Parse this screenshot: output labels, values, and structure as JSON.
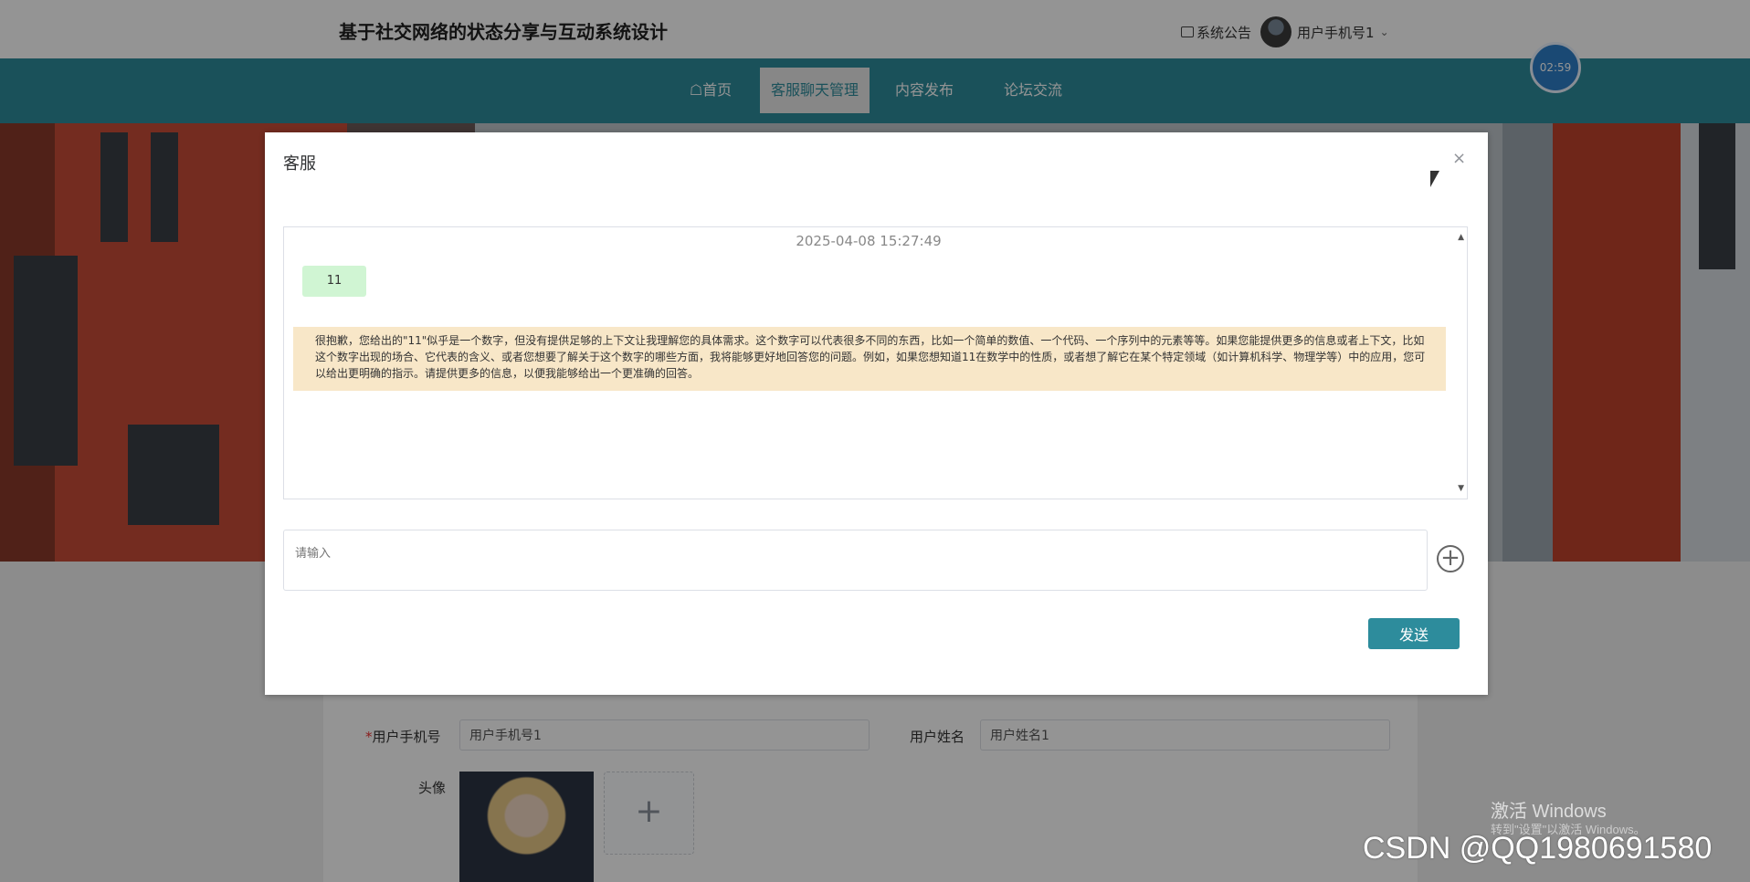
{
  "header": {
    "site_title": "基于社交网络的状态分享与互动系统设计",
    "notice_label": "系统公告",
    "username": "用户手机号1",
    "chevron": "⌄"
  },
  "nav": {
    "home": "☖首页",
    "chat": "客服聊天管理",
    "publish": "内容发布",
    "forum": "论坛交流"
  },
  "timer": "02:59",
  "form": {
    "phone_label": "用户手机号",
    "phone_value": "用户手机号1",
    "name_label": "用户姓名",
    "name_value": "用户姓名1",
    "avatar_label": "头像",
    "upload_plus": "+"
  },
  "modal": {
    "title": "客服",
    "close": "×",
    "timestamp": "2025-04-08 15:27:49",
    "user_message": "11",
    "bot_message": "很抱歉，您给出的\"11\"似乎是一个数字，但没有提供足够的上下文让我理解您的具体需求。这个数字可以代表很多不同的东西，比如一个简单的数值、一个代码、一个序列中的元素等等。如果您能提供更多的信息或者上下文，比如这个数字出现的场合、它代表的含义、或者您想要了解关于这个数字的哪些方面，我将能够更好地回答您的问题。例如，如果您想知道11在数学中的性质，或者想了解它在某个特定领域（如计算机科学、物理学等）中的应用，您可以给出更明确的指示。请提供更多的信息，以便我能够给出一个更准确的回答。",
    "input_placeholder": "请输入",
    "plus": "+",
    "send": "发送"
  },
  "watermark": "CSDN @QQ1980691580",
  "windows_activation": {
    "line1": "激活 Windows",
    "line2": "转到\"设置\"以激活 Windows。"
  }
}
